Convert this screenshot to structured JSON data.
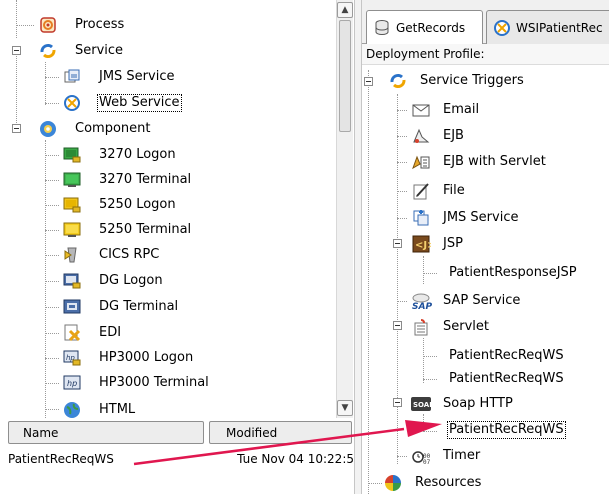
{
  "left_tree": {
    "items": [
      {
        "label": "Process",
        "icon": "process-icon"
      },
      {
        "label": "Service",
        "icon": "service-icon"
      },
      {
        "label": "JMS Service",
        "icon": "jms-service-icon"
      },
      {
        "label": "Web Service",
        "icon": "web-service-icon",
        "selected": true
      },
      {
        "label": "Component",
        "icon": "component-icon"
      },
      {
        "label": "3270 Logon",
        "icon": "terminal-logon-icon"
      },
      {
        "label": "3270 Terminal",
        "icon": "terminal-icon"
      },
      {
        "label": "5250 Logon",
        "icon": "terminal-logon-icon"
      },
      {
        "label": "5250 Terminal",
        "icon": "terminal-icon"
      },
      {
        "label": "CICS RPC",
        "icon": "cics-rpc-icon"
      },
      {
        "label": "DG Logon",
        "icon": "dg-logon-icon"
      },
      {
        "label": "DG Terminal",
        "icon": "dg-terminal-icon"
      },
      {
        "label": "EDI",
        "icon": "edi-icon"
      },
      {
        "label": "HP3000 Logon",
        "icon": "hp-logon-icon"
      },
      {
        "label": "HP3000 Terminal",
        "icon": "hp-terminal-icon"
      },
      {
        "label": "HTML",
        "icon": "html-icon"
      }
    ]
  },
  "table": {
    "columns": [
      "Name",
      "Modified"
    ],
    "rows": [
      {
        "name": "PatientRecReqWS",
        "modified": "Tue Nov 04 10:22:5"
      }
    ]
  },
  "tabs": [
    {
      "label": "GetRecords",
      "icon": "database-icon",
      "active": true
    },
    {
      "label": "WSIPatientRec",
      "icon": "web-service-icon",
      "active": false
    }
  ],
  "deployment_profile_label": "Deployment Profile:",
  "right_tree": {
    "items": [
      {
        "label": "Service Triggers",
        "icon": "service-icon"
      },
      {
        "label": "Email",
        "icon": "email-icon"
      },
      {
        "label": "EJB",
        "icon": "ejb-icon"
      },
      {
        "label": "EJB with Servlet",
        "icon": "ejb-servlet-icon"
      },
      {
        "label": "File",
        "icon": "file-icon"
      },
      {
        "label": "JMS Service",
        "icon": "jms-service-icon"
      },
      {
        "label": "JSP",
        "icon": "jsp-icon"
      },
      {
        "label": "PatientResponseJSP",
        "icon": ""
      },
      {
        "label": "SAP Service",
        "icon": "sap-icon"
      },
      {
        "label": "Servlet",
        "icon": "servlet-icon"
      },
      {
        "label": "PatientRecReqWS",
        "icon": ""
      },
      {
        "label": "PatientRecReqWS",
        "icon": ""
      },
      {
        "label": "Soap HTTP",
        "icon": "soap-icon"
      },
      {
        "label": "PatientRecReqWS",
        "icon": "",
        "selected": true
      },
      {
        "label": "Timer",
        "icon": "timer-icon"
      },
      {
        "label": "Resources",
        "icon": "resources-icon"
      }
    ]
  },
  "colors": {
    "arrow": "#e0174f",
    "selection_border": "#000000"
  }
}
